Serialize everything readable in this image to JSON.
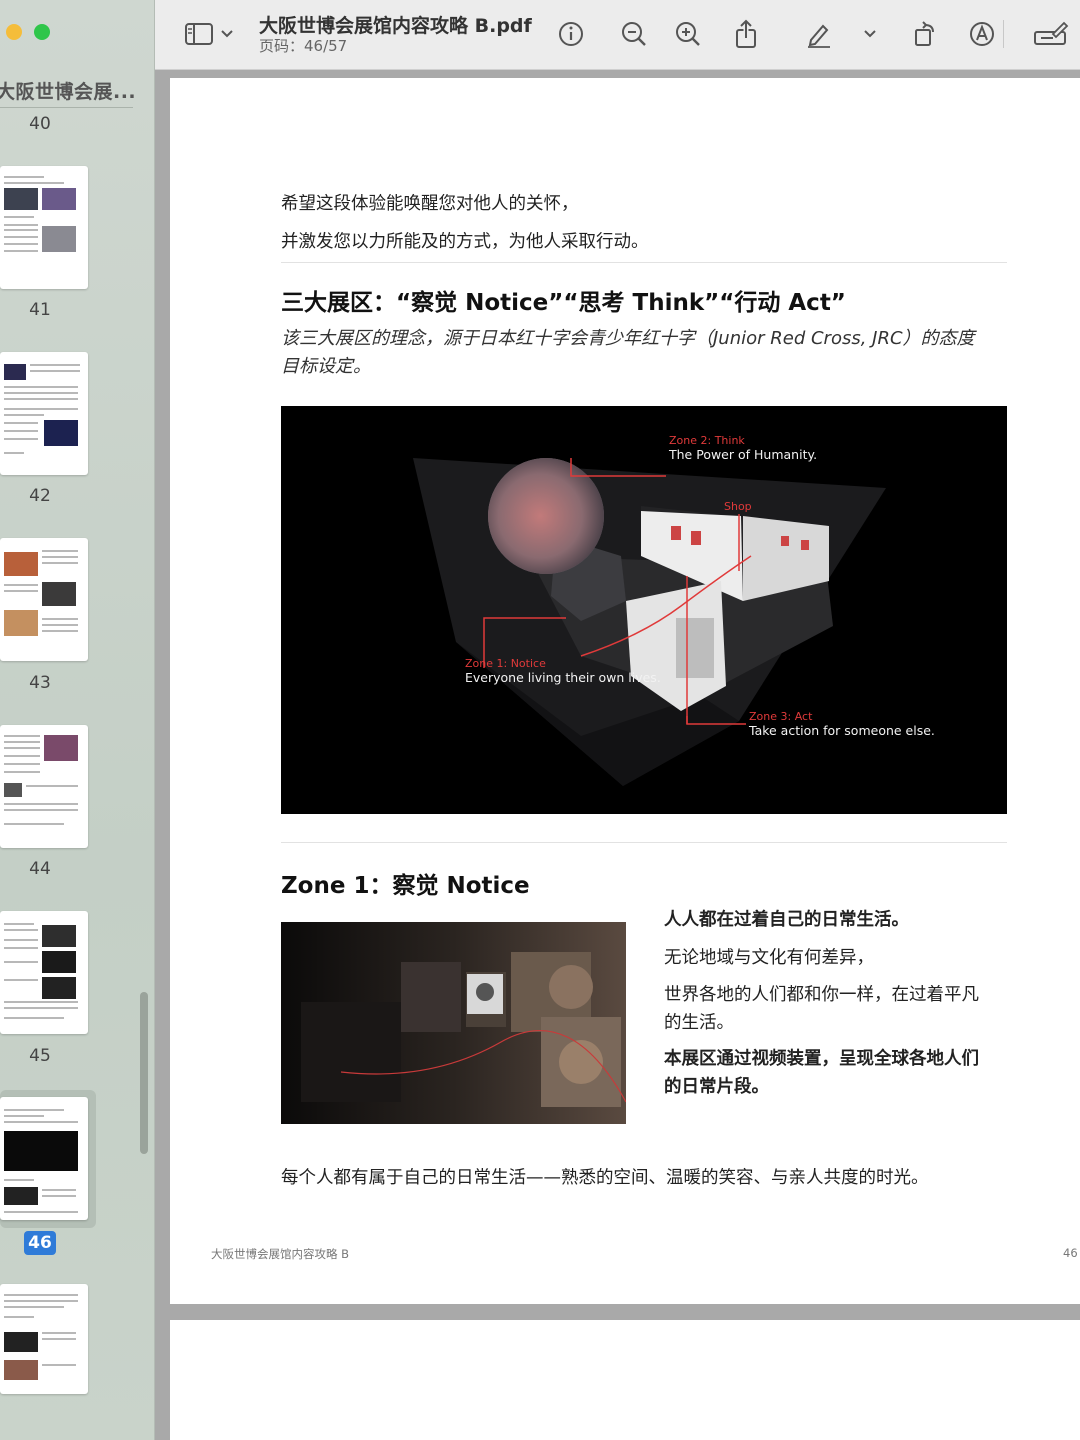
{
  "window": {
    "doc_title": "大阪世博会展馆内容攻略 B.pdf",
    "page_indicator": "页码：46/57"
  },
  "sidebar": {
    "title": "大阪世博会展...",
    "pages": [
      "40",
      "41",
      "42",
      "43",
      "44",
      "45",
      "46"
    ],
    "selected_page": "46"
  },
  "toolbar": {
    "icons": [
      "sidebar-toggle-icon",
      "chevron-down-icon",
      "info-icon",
      "zoom-out-icon",
      "zoom-in-icon",
      "share-icon",
      "markup-pen-icon",
      "chevron-down-icon",
      "rotate-icon",
      "annotate-icon",
      "edit-toolbar-icon"
    ]
  },
  "page": {
    "intro_line1": "希望这段体验能唤醒您对他人的关怀，",
    "intro_line2": "并激发您以力所能及的方式，为他人采取行动。",
    "section_heading": "三大展区：“察觉 Notice”“思考 Think”“行动 Act”",
    "section_sub_line1": "该三大展区的理念，源于日本红十字会青少年红十字（Junior Red Cross, JRC）的态度",
    "section_sub_line2": "目标设定。",
    "diagram": {
      "zone2_title": "Zone 2: Think",
      "zone2_desc": "The Power of Humanity.",
      "shop": "Shop",
      "zone1_title": "Zone 1: Notice",
      "zone1_desc": "Everyone living their own lives.",
      "zone3_title": "Zone 3: Act",
      "zone3_desc": "Take action for someone else."
    },
    "zone1_heading": "Zone 1：察觉 Notice",
    "zone1_p1": "人人都在过着自己的日常生活。",
    "zone1_p2": "无论地域与文化有何差异，",
    "zone1_p3_line1": "世界各地的人们都和你一样，在过着平凡",
    "zone1_p3_line2": "的生活。",
    "zone1_p4_line1": "本展区通过视频装置，呈现全球各地人们",
    "zone1_p4_line2": "的日常片段。",
    "closing": "每个人都有属于自己的日常生活——熟悉的空间、温暖的笑容、与亲人共度的时光。",
    "footer_left": "大阪世博会展馆内容攻略 B",
    "footer_right": "46"
  },
  "colors": {
    "accent_red": "#e03a3a",
    "selection_blue": "#2f7bd8"
  }
}
